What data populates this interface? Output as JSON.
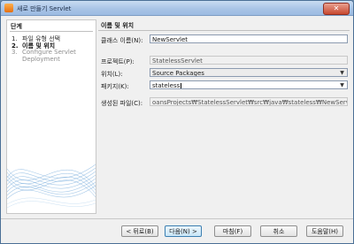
{
  "window": {
    "title": "새로 만들기 Servlet",
    "close_symbol": "✕"
  },
  "steps": {
    "title": "단계",
    "items": [
      {
        "num": "1.",
        "label": "파일 유형 선택",
        "state": "normal"
      },
      {
        "num": "2.",
        "label": "이름 및 위치",
        "state": "active"
      },
      {
        "num": "3.",
        "label": "Configure Servlet",
        "label2": "Deployment",
        "state": "disabled"
      }
    ]
  },
  "form": {
    "section_title": "이름 및 위치",
    "class_name_label": "클래스 이름(N):",
    "class_name_value": "NewServlet",
    "project_label": "프로젝트(P):",
    "project_value": "StatelessServlet",
    "location_label": "위치(L):",
    "location_value": "Source Packages",
    "package_label": "패키지(K):",
    "package_value": "stateless",
    "created_file_label": "생성된 파일(C):",
    "created_file_value": "oansProjects₩StatelessServlet₩src₩java₩stateless₩NewServlet.java"
  },
  "buttons": {
    "back": "< 뒤로(B)",
    "next": "다음(N) >",
    "finish": "마침(F)",
    "cancel": "취소",
    "help": "도움말(H)"
  },
  "colors": {
    "accent": "#3c7fb1",
    "title_bar": "#a9c4e6",
    "close": "#c7472f"
  }
}
